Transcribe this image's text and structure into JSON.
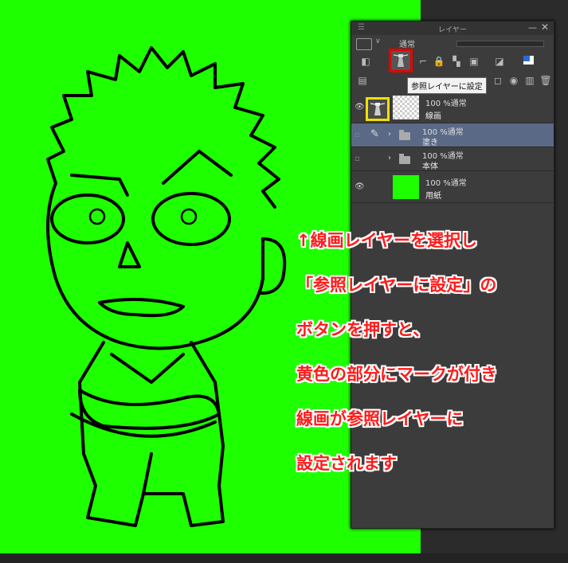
{
  "panel": {
    "title": "レイヤー",
    "menu_icon": "hamburger-icon",
    "minimize_glyph": "—",
    "close_glyph": "✕",
    "blend_mode": "通常",
    "tooltip": "参照レイヤーに設定"
  },
  "layers": [
    {
      "visibility": "visible",
      "opacity_mode": "100 %通常",
      "name": "線画",
      "icon": "reference-layer-icon",
      "thumbnail": "transparent"
    },
    {
      "visibility": "hidden",
      "opacity_mode": "100 %通常",
      "name": "塗き",
      "icon": "folder-icon",
      "thumbnail": "folder"
    },
    {
      "visibility": "hidden",
      "opacity_mode": "100 %通常",
      "name": "本体",
      "icon": "folder-icon",
      "thumbnail": "folder"
    },
    {
      "visibility": "visible",
      "opacity_mode": "100 %通常",
      "name": "用紙",
      "icon": "paper-icon",
      "thumbnail": "green"
    }
  ],
  "annotation": {
    "lines": [
      "↑線画レイヤーを選択し",
      "「参照レイヤーに設定」の",
      "ボタンを押すと、",
      "黄色の部分にマークが付き",
      "線画が参照レイヤーに",
      "設定されます"
    ]
  },
  "colors": {
    "canvas": "#1eff00",
    "highlight_red": "#e40000",
    "highlight_yellow": "#f0e000",
    "annotation_text": "#ff1a1a"
  }
}
